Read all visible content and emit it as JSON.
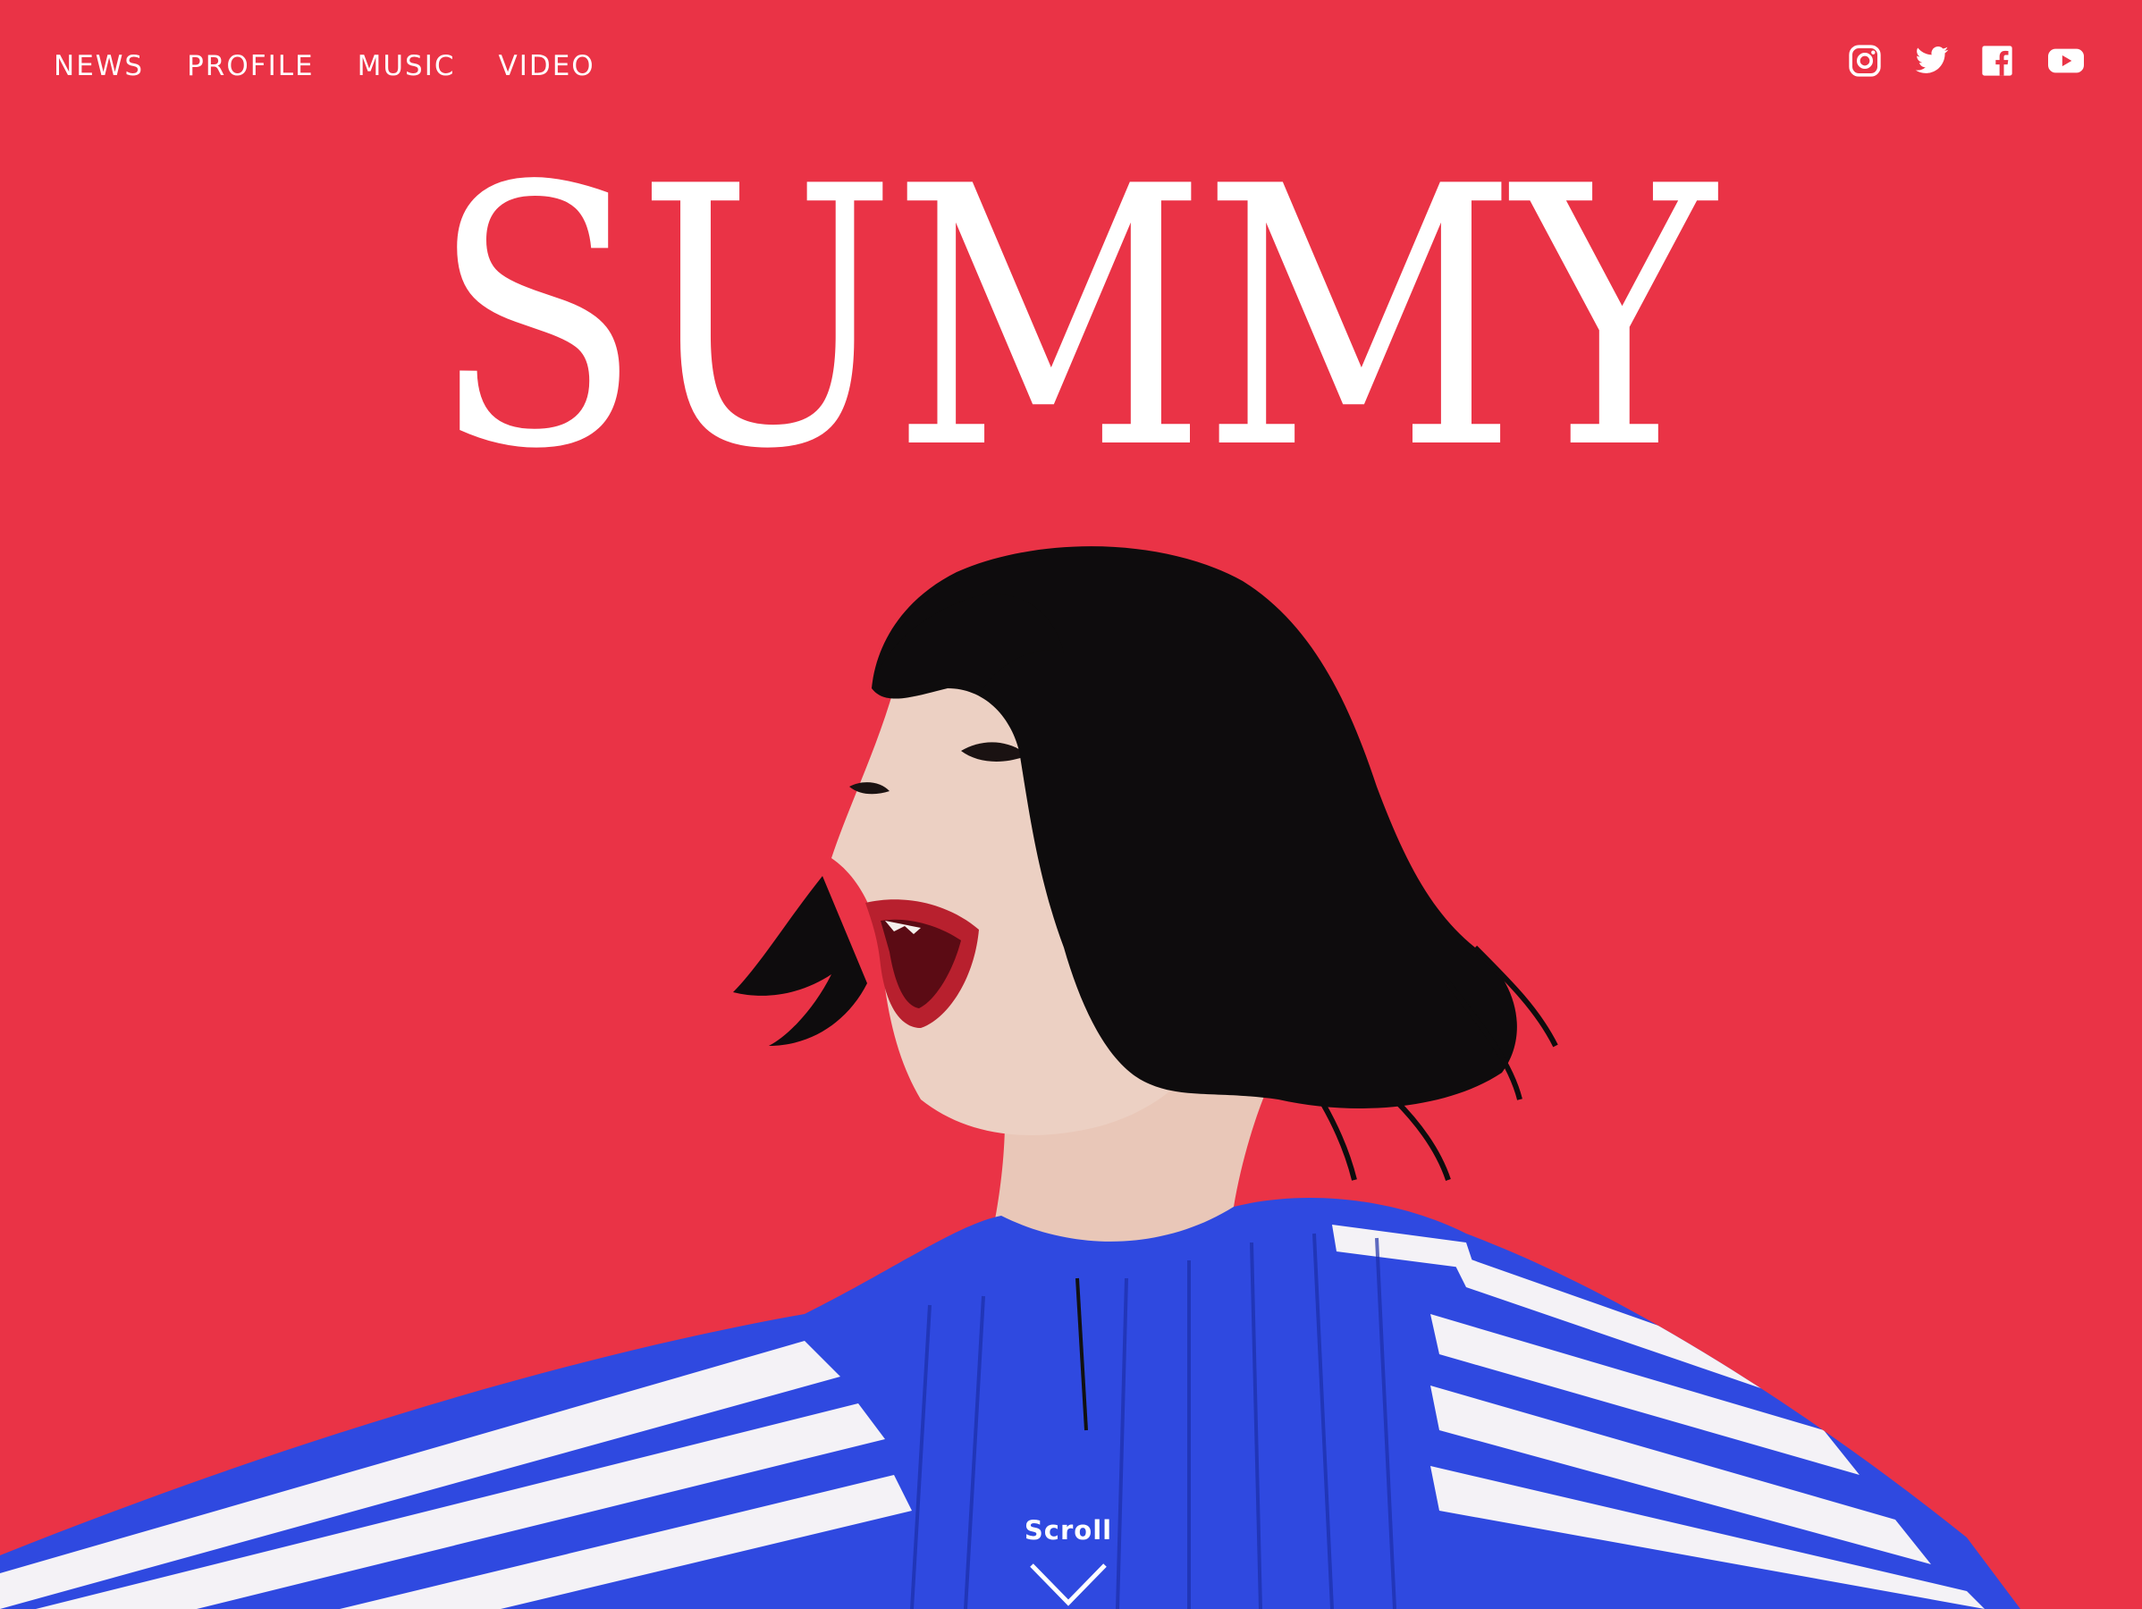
{
  "nav": {
    "items": [
      {
        "label": "NEWS"
      },
      {
        "label": "PROFILE"
      },
      {
        "label": "MUSIC"
      },
      {
        "label": "VIDEO"
      }
    ]
  },
  "social": {
    "icons": [
      "instagram-icon",
      "twitter-icon",
      "facebook-icon",
      "youtube-icon"
    ]
  },
  "hero": {
    "logo": "SUMMY",
    "background_color": "#ea3346",
    "photo": "woman with black bob haircut in blue and white striped top, mouth open"
  },
  "scroll": {
    "label": "Scroll"
  }
}
